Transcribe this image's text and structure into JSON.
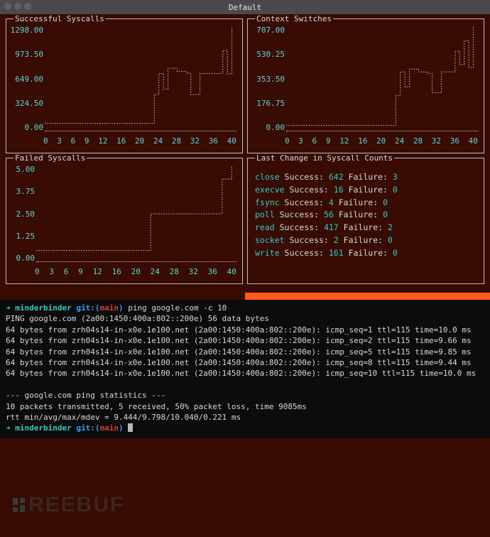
{
  "window": {
    "title": "Default"
  },
  "panels": {
    "p1": {
      "title": "Successful Syscalls"
    },
    "p2": {
      "title": "Context Switches"
    },
    "p3": {
      "title": "Failed Syscalls"
    },
    "p4": {
      "title": "Last Change in Syscall Counts"
    }
  },
  "syscall_counts": [
    {
      "name": "close",
      "success": "642",
      "failure": "3"
    },
    {
      "name": "execve",
      "success": "16",
      "failure": "0"
    },
    {
      "name": "fsync",
      "success": "4",
      "failure": "0"
    },
    {
      "name": "poll",
      "success": "56",
      "failure": "0"
    },
    {
      "name": "read",
      "success": "417",
      "failure": "2"
    },
    {
      "name": "socket",
      "success": "2",
      "failure": "0"
    },
    {
      "name": "write",
      "success": "161",
      "failure": "0"
    }
  ],
  "labels": {
    "success": " Success: ",
    "failure": " Failure: "
  },
  "chart_data": [
    {
      "id": "successful_syscalls",
      "type": "line",
      "title": "Successful Syscalls",
      "xlabel": "",
      "ylabel": "",
      "xlim": [
        0,
        42
      ],
      "ylim": [
        0,
        1298
      ],
      "y_ticks": [
        "1298.00",
        "973.50",
        "649.00",
        "324.50",
        "0.00"
      ],
      "x_ticks": [
        "0",
        "3",
        "6",
        "9",
        "12",
        "16",
        "20",
        "24",
        "28",
        "32",
        "36",
        "40"
      ],
      "x": [
        0,
        1,
        2,
        3,
        4,
        5,
        6,
        7,
        8,
        9,
        10,
        11,
        12,
        13,
        14,
        15,
        16,
        17,
        18,
        19,
        20,
        21,
        22,
        23,
        24,
        25,
        26,
        27,
        28,
        29,
        30,
        31,
        32,
        33,
        34,
        35,
        36,
        37,
        38,
        39,
        40,
        41
      ],
      "values": [
        100,
        100,
        100,
        100,
        100,
        100,
        100,
        100,
        100,
        100,
        100,
        100,
        100,
        100,
        100,
        100,
        100,
        100,
        100,
        100,
        100,
        100,
        100,
        100,
        455,
        715,
        520,
        780,
        780,
        740,
        740,
        720,
        455,
        455,
        715,
        715,
        715,
        715,
        715,
        1000,
        710,
        1298
      ]
    },
    {
      "id": "context_switches",
      "type": "line",
      "title": "Context Switches",
      "xlabel": "",
      "ylabel": "",
      "xlim": [
        0,
        42
      ],
      "ylim": [
        0,
        707
      ],
      "y_ticks": [
        "707.00",
        "530.25",
        "353.50",
        "176.75",
        "0.00"
      ],
      "x_ticks": [
        "0",
        "3",
        "6",
        "9",
        "12",
        "16",
        "20",
        "24",
        "28",
        "32",
        "36",
        "40"
      ],
      "x": [
        0,
        1,
        2,
        3,
        4,
        5,
        6,
        7,
        8,
        9,
        10,
        11,
        12,
        13,
        14,
        15,
        16,
        17,
        18,
        19,
        20,
        21,
        22,
        23,
        24,
        25,
        26,
        27,
        28,
        29,
        30,
        31,
        32,
        33,
        34,
        35,
        36,
        37,
        38,
        39,
        40,
        41
      ],
      "values": [
        40,
        40,
        40,
        40,
        40,
        40,
        40,
        40,
        40,
        40,
        40,
        40,
        40,
        40,
        40,
        40,
        40,
        40,
        40,
        40,
        40,
        40,
        40,
        40,
        240,
        400,
        300,
        420,
        420,
        400,
        400,
        390,
        260,
        260,
        400,
        400,
        400,
        540,
        450,
        610,
        430,
        707
      ]
    },
    {
      "id": "failed_syscalls",
      "type": "line",
      "title": "Failed Syscalls",
      "xlabel": "",
      "ylabel": "",
      "xlim": [
        0,
        42
      ],
      "ylim": [
        0,
        5
      ],
      "y_ticks": [
        "5.00",
        "3.75",
        "2.50",
        "1.25",
        "0.00"
      ],
      "x_ticks": [
        "0",
        "3",
        "6",
        "9",
        "12",
        "16",
        "20",
        "24",
        "28",
        "32",
        "36",
        "40"
      ],
      "x": [
        0,
        1,
        2,
        3,
        4,
        5,
        6,
        7,
        8,
        9,
        10,
        11,
        12,
        13,
        14,
        15,
        16,
        17,
        18,
        19,
        20,
        21,
        22,
        23,
        24,
        25,
        26,
        27,
        28,
        29,
        30,
        31,
        32,
        33,
        34,
        35,
        36,
        37,
        38,
        39,
        40,
        41
      ],
      "values": [
        0.6,
        0.6,
        0.6,
        0.6,
        0.6,
        0.6,
        0.6,
        0.6,
        0.6,
        0.6,
        0.6,
        0.6,
        0.6,
        0.6,
        0.6,
        0.6,
        0.6,
        0.6,
        0.6,
        0.6,
        0.6,
        0.6,
        0.6,
        0.6,
        2.5,
        2.5,
        2.5,
        2.5,
        2.5,
        2.5,
        2.5,
        2.5,
        2.5,
        2.5,
        2.5,
        2.5,
        2.5,
        2.5,
        2.5,
        4.3,
        4.3,
        5.0
      ]
    }
  ],
  "prompt": {
    "arrow": "➜ ",
    "host": "minderbinder",
    "git_prefix": " git:(",
    "branch": "main",
    "git_suffix": ") ",
    "command1": "ping google.com -c 10"
  },
  "term_lines": [
    "PING google.com (2a00:1450:400a:802::200e) 56 data bytes",
    "64 bytes from zrh04s14-in-x0e.1e100.net (2a00:1450:400a:802::200e): icmp_seq=1 ttl=115 time=10.0 ms",
    "64 bytes from zrh04s14-in-x0e.1e100.net (2a00:1450:400a:802::200e): icmp_seq=2 ttl=115 time=9.66 ms",
    "64 bytes from zrh04s14-in-x0e.1e100.net (2a00:1450:400a:802::200e): icmp_seq=5 ttl=115 time=9.85 ms",
    "64 bytes from zrh04s14-in-x0e.1e100.net (2a00:1450:400a:802::200e): icmp_seq=8 ttl=115 time=9.44 ms",
    "64 bytes from zrh04s14-in-x0e.1e100.net (2a00:1450:400a:802::200e): icmp_seq=10 ttl=115 time=10.0 ms"
  ],
  "term_stats": {
    "hdr": "--- google.com ping statistics ---",
    "l1": "10 packets transmitted, 5 received, 50% packet loss, time 9085ms",
    "l2": "rtt min/avg/max/mdev = 9.444/9.798/10.040/0.221 ms"
  },
  "watermark": "REEBUF"
}
